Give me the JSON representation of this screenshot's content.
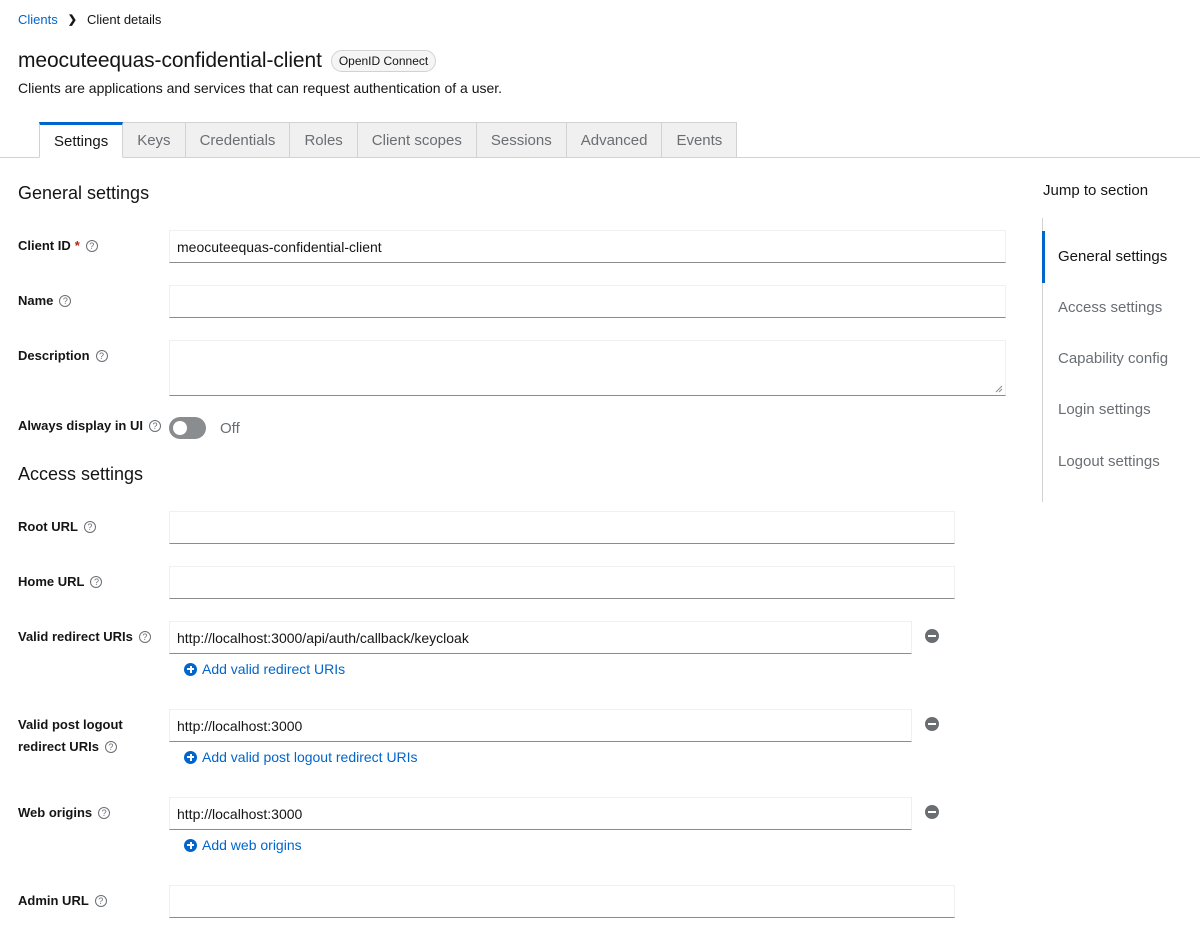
{
  "breadcrumb": {
    "parent": "Clients",
    "current": "Client details"
  },
  "header": {
    "title": "meocuteequas-confidential-client",
    "badge": "OpenID Connect",
    "subtitle": "Clients are applications and services that can request authentication of a user."
  },
  "tabs": [
    "Settings",
    "Keys",
    "Credentials",
    "Roles",
    "Client scopes",
    "Sessions",
    "Advanced",
    "Events"
  ],
  "active_tab": "Settings",
  "general": {
    "title": "General settings",
    "client_id_label": "Client ID",
    "client_id_value": "meocuteequas-confidential-client",
    "name_label": "Name",
    "name_value": "",
    "description_label": "Description",
    "description_value": "",
    "always_display_label": "Always display in UI",
    "always_display_state": "Off"
  },
  "access": {
    "title": "Access settings",
    "root_url_label": "Root URL",
    "root_url_value": "",
    "home_url_label": "Home URL",
    "home_url_value": "",
    "redirect_label": "Valid redirect URIs",
    "redirect_value": "http://localhost:3000/api/auth/callback/keycloak",
    "add_redirect": "Add valid redirect URIs",
    "post_logout_label_1": "Valid post logout",
    "post_logout_label_2": "redirect URIs",
    "post_logout_value": "http://localhost:3000",
    "add_post_logout": "Add valid post logout redirect URIs",
    "web_origins_label": "Web origins",
    "web_origins_value": "http://localhost:3000",
    "add_web_origins": "Add web origins",
    "admin_url_label": "Admin URL",
    "admin_url_value": ""
  },
  "jump": {
    "title": "Jump to section",
    "items": [
      "General settings",
      "Access settings",
      "Capability config",
      "Login settings",
      "Logout settings"
    ],
    "active": "General settings"
  },
  "colors": {
    "accent": "#0066cc",
    "required": "#c9190b",
    "muted": "#6a6e73"
  }
}
